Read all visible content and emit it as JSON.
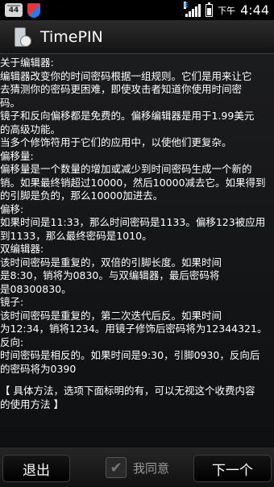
{
  "status_bar": {
    "notification_badge": "44",
    "ampm": "下午",
    "time": "4:44",
    "network_type": "E"
  },
  "app": {
    "title": "TimePIN"
  },
  "content": {
    "lines": [
      "关于编辑器:",
      "编辑器改变你的时间密码根据一组规则。它们是用来让它",
      "去猜测你的密码更困难，即使攻击者知道你使用时间密",
      "码。",
      "镜子和反向偏移都是免费的。偏移编辑器是用于1.99美元",
      "的高级功能。",
      "当多个修饰符用于它们的应用中，以使他们更复杂。",
      "偏移量:",
      "偏移量是一个数量的增加或减少到时间密码生成一个新的",
      "销。如果最终销超过10000，然后10000减去它。如果得到",
      "的引脚是负的，那么10000加进去。",
      "偏移:",
      "如果时间是11:33，那么时间密码是1133。偏移123被应用",
      "到1133，那么最终密码是1010。",
      "双编辑器:",
      "该时间密码是重复的，双倍的引脚长度。如果时间",
      "是8:30，销将为0830。与双编辑器，最后密码将",
      "是08300830。",
      "镜子:",
      "该时间密码是重复的，第二次迭代后反。如果时间",
      "为12:34，销将1234。用镜子修饰后密码将为12344321。",
      "反向:",
      "时间密码是相反的。如果时间是9:30，引脚0930，反向后",
      "的密码将为0390"
    ],
    "note_lines": [
      "【 具体方法，选项下面标明的有，可以无视这个收费内容",
      "的使用方法 】"
    ]
  },
  "bottom_bar": {
    "exit_label": "退出",
    "agree_label": "我同意",
    "agree_checked": true,
    "next_label": "下一个"
  }
}
